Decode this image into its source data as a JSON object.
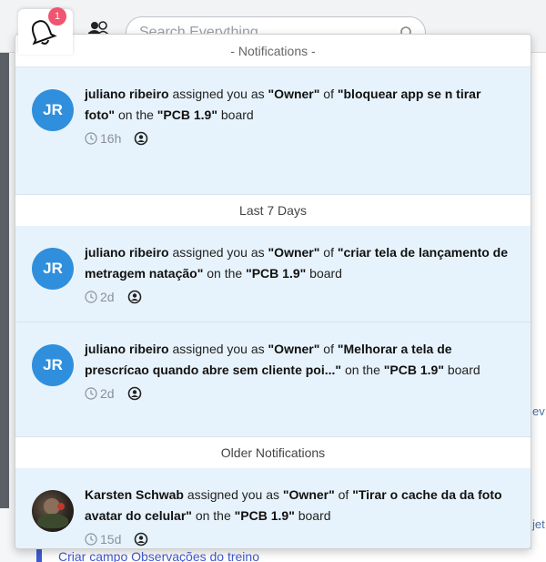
{
  "search": {
    "placeholder": "Search Everything"
  },
  "badge_count": "1",
  "dropdown": {
    "title": "- Notifications -",
    "sections": {
      "last7": "Last 7 Days",
      "older": "Older Notifications"
    },
    "notifications": [
      {
        "initials": "JR",
        "user": "juliano ribeiro",
        "action": "assigned you as",
        "role": "\"Owner\"",
        "of": "of",
        "task": "\"bloquear app se n tirar foto\"",
        "on": "on the",
        "board": "\"PCB 1.9\"",
        "suffix": "board",
        "time": "16h"
      },
      {
        "initials": "JR",
        "user": "juliano ribeiro",
        "action": "assigned you as",
        "role": "\"Owner\"",
        "of": "of",
        "task": "\"criar tela de lançamento de metragem natação\"",
        "on": "on the",
        "board": "\"PCB 1.9\"",
        "suffix": "board",
        "time": "2d"
      },
      {
        "initials": "JR",
        "user": "juliano ribeiro",
        "action": "assigned you as",
        "role": "\"Owner\"",
        "of": "of",
        "task": "\"Melhorar a tela de prescrícao quando abre sem cliente poi...\"",
        "on": "on the",
        "board": "\"PCB 1.9\"",
        "suffix": "board",
        "time": "2d"
      },
      {
        "initials": "",
        "user": "Karsten Schwab",
        "action": "assigned you as",
        "role": "\"Owner\"",
        "of": "of",
        "task": "\"Tirar o cache da da foto avatar do celular\"",
        "on": "on the",
        "board": "\"PCB 1.9\"",
        "suffix": "board",
        "time": "15d"
      }
    ]
  },
  "background": {
    "peek_ev": "ev",
    "peek_jet": "jet",
    "bottom_item": "Criar campo Observações do treino"
  },
  "colors": {
    "accent": "#2f8fdc",
    "badge": "#f0546e",
    "notif_bg": "#e7f3fc"
  }
}
